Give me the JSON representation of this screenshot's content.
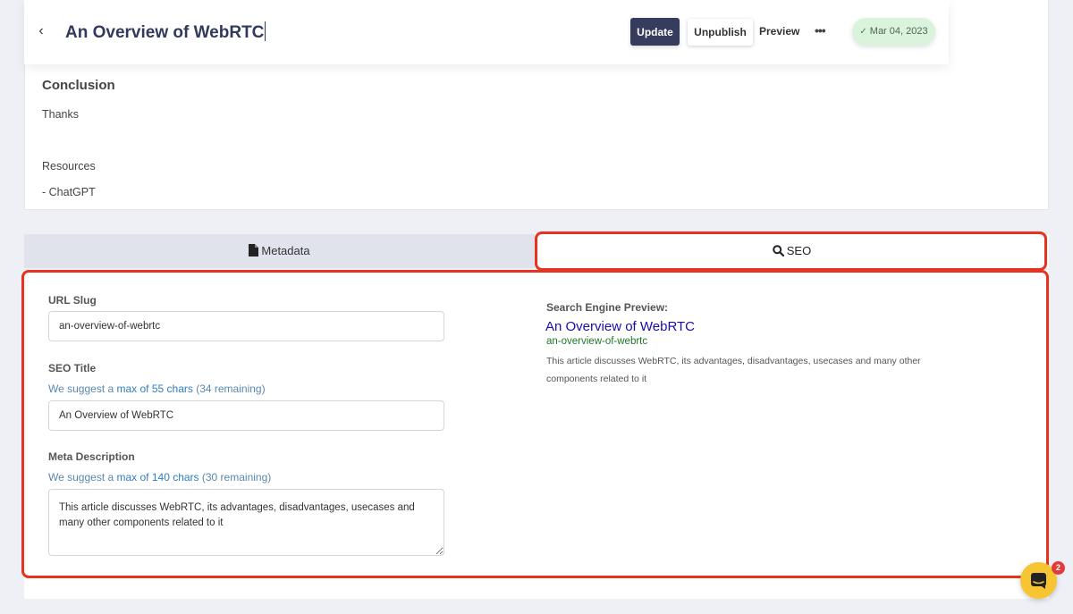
{
  "header": {
    "title": "An Overview of WebRTC",
    "update_label": "Update",
    "unpublish_label": "Unpublish",
    "preview_label": "Preview",
    "more_icon": "•••",
    "status_icon": "✓",
    "date": "Mar 04, 2023"
  },
  "editor": {
    "heading": "Conclusion",
    "lines": [
      "Thanks",
      "Resources",
      "- ChatGPT"
    ]
  },
  "tabs": {
    "metadata_label": "Metadata",
    "seo_label": "SEO"
  },
  "seo": {
    "url_slug_label": "URL Slug",
    "url_slug_value": "an-overview-of-webrtc",
    "title_label": "SEO Title",
    "title_hint_prefix": "We suggest a ",
    "title_hint_link": "max of 55 chars",
    "title_hint_suffix": " (34 remaining)",
    "title_value": "An Overview of WebRTC",
    "desc_label": "Meta Description",
    "desc_hint_prefix": "We suggest a ",
    "desc_hint_link": "max of 140 chars",
    "desc_hint_suffix": " (30 remaining)",
    "desc_value": "This article discusses WebRTC, its advantages, disadvantages, usecases and many other components related to it"
  },
  "preview": {
    "label": "Search Engine Preview:",
    "title": "An Overview of WebRTC",
    "url": "an-overview-of-webrtc",
    "description": "This article discusses WebRTC, its advantages, disadvantages, usecases and many other components related to it"
  },
  "chat": {
    "badge_count": "2"
  },
  "colors": {
    "accent": "#353c5e",
    "highlight": "#e6321e",
    "brand_yellow": "#f6c531",
    "status_green": "#d9f3dc"
  }
}
